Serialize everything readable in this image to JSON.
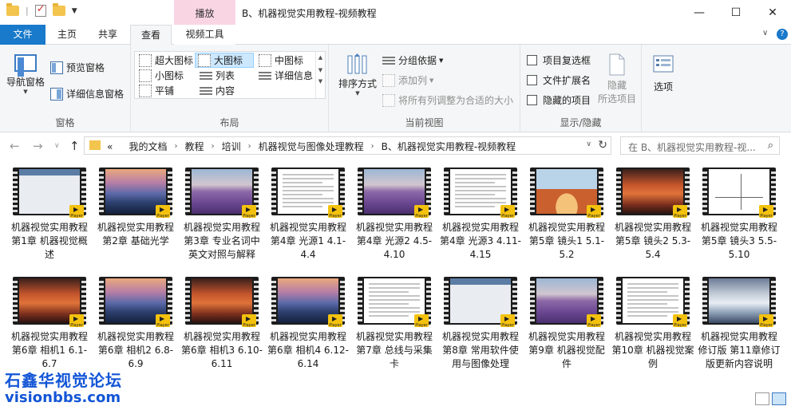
{
  "window": {
    "title": "B、机器视觉实用教程-视频教程",
    "context_tab": "播放",
    "min_glyph": "—",
    "max_glyph": "☐",
    "close_glyph": "✕"
  },
  "tabs": {
    "file": "文件",
    "home": "主页",
    "share": "共享",
    "view": "查看",
    "video_tools": "视频工具",
    "help_glyph": "?",
    "collapse_glyph": "∨"
  },
  "ribbon": {
    "panes": {
      "label": "窗格",
      "nav_pane": "导航窗格",
      "preview_pane": "预览窗格",
      "details_pane": "详细信息窗格"
    },
    "layout": {
      "label": "布局",
      "items": [
        "超大图标",
        "大图标",
        "中图标",
        "小图标",
        "列表",
        "详细信息",
        "平铺",
        "内容"
      ],
      "selected": "大图标"
    },
    "current_view": {
      "label": "当前视图",
      "sort_by": "排序方式",
      "group_by": "分组依据",
      "add_columns": "添加列",
      "size_all_columns": "将所有列调整为合适的大小"
    },
    "show_hide": {
      "label": "显示/隐藏",
      "item_checkboxes": "项目复选框",
      "file_extensions": "文件扩展名",
      "hidden_items": "隐藏的项目",
      "hide": "隐藏",
      "hide_selected": "所选项目"
    },
    "options": {
      "label": "选项"
    }
  },
  "address": {
    "prefix": "«",
    "crumbs": [
      "我的文档",
      "教程",
      "培训",
      "机器视觉与图像处理教程",
      "B、机器视觉实用教程-视频教程"
    ],
    "search_placeholder": "在 B、机器视觉实用教程-视..."
  },
  "files": [
    {
      "name": "机器视觉实用教程 第1章 机器视觉概述",
      "scene": "app"
    },
    {
      "name": "机器视觉实用教程 第2章 基础光学",
      "scene": "sea"
    },
    {
      "name": "机器视觉实用教程 第3章 专业名词中英文对照与解释",
      "scene": "lav"
    },
    {
      "name": "机器视觉实用教程 第4章 光源1 4.1-4.4",
      "scene": "doc"
    },
    {
      "name": "机器视觉实用教程 第4章 光源2 4.5-4.10",
      "scene": "lav"
    },
    {
      "name": "机器视觉实用教程 第4章 光源3 4.11-4.15",
      "scene": "doc"
    },
    {
      "name": "机器视觉实用教程 第5章 镜头1 5.1-5.2",
      "scene": "arch"
    },
    {
      "name": "机器视觉实用教程 第5章 镜头2 5.3-5.4",
      "scene": "can"
    },
    {
      "name": "机器视觉实用教程 第5章 镜头3 5.5-5.10",
      "scene": "graph"
    },
    {
      "name": "机器视觉实用教程 第6章 相机1 6.1-6.7",
      "scene": "can"
    },
    {
      "name": "机器视觉实用教程 第6章 相机2 6.8-6.9",
      "scene": "sea"
    },
    {
      "name": "机器视觉实用教程 第6章 相机3 6.10-6.11",
      "scene": "can"
    },
    {
      "name": "机器视觉实用教程 第6章 相机4 6.12-6.14",
      "scene": "sea"
    },
    {
      "name": "机器视觉实用教程 第7章 总线与采集卡",
      "scene": "doc"
    },
    {
      "name": "机器视觉实用教程 第8章 常用软件使用与图像处理",
      "scene": "app"
    },
    {
      "name": "机器视觉实用教程 第9章 机器视觉配件",
      "scene": "lav"
    },
    {
      "name": "机器视觉实用教程 第10章 机器视觉案例",
      "scene": "doc"
    },
    {
      "name": "机器视觉实用教程修订版 第11章修订版更新内容说明",
      "scene": "ice"
    }
  ],
  "badge_text": "Player",
  "watermark": {
    "line1": "石鑫华视觉论坛",
    "line2": "visionbbs.com"
  },
  "colors": {
    "accent": "#1979ca",
    "badge": "#f4c20d",
    "watermark": "#1255d6"
  }
}
